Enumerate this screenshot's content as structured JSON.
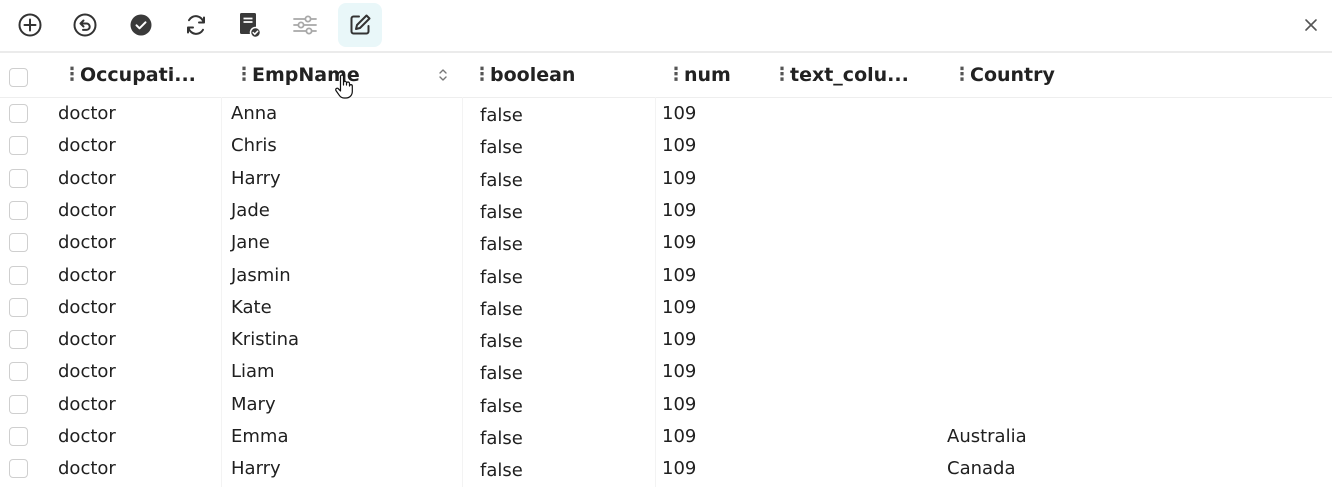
{
  "toolbar": {
    "buttons": [
      {
        "name": "add-row-button",
        "icon": "plus-circle-icon",
        "active": false
      },
      {
        "name": "undo-button",
        "icon": "undo-icon",
        "active": false
      },
      {
        "name": "confirm-button",
        "icon": "check-circle-icon",
        "active": false
      },
      {
        "name": "refresh-button",
        "icon": "refresh-icon",
        "active": false
      },
      {
        "name": "save-changes-button",
        "icon": "document-check-icon",
        "active": false
      },
      {
        "name": "filter-settings-button",
        "icon": "sliders-icon",
        "active": false
      },
      {
        "name": "edit-button",
        "icon": "edit-icon",
        "active": true
      }
    ],
    "close_icon": "close-icon"
  },
  "grid": {
    "columns": [
      {
        "key": "occupation",
        "label": "Occupati..."
      },
      {
        "key": "empname",
        "label": "EmpName"
      },
      {
        "key": "boolean",
        "label": "boolean"
      },
      {
        "key": "num",
        "label": "num"
      },
      {
        "key": "text_column",
        "label": "text_colu..."
      },
      {
        "key": "country",
        "label": "Country"
      }
    ],
    "rows": [
      {
        "occupation": "doctor",
        "empname": "Anna",
        "boolean": "false",
        "num": "109",
        "text_column": "",
        "country": ""
      },
      {
        "occupation": "doctor",
        "empname": "Chris",
        "boolean": "false",
        "num": "109",
        "text_column": "",
        "country": ""
      },
      {
        "occupation": "doctor",
        "empname": "Harry",
        "boolean": "false",
        "num": "109",
        "text_column": "",
        "country": ""
      },
      {
        "occupation": "doctor",
        "empname": "Jade",
        "boolean": "false",
        "num": "109",
        "text_column": "",
        "country": ""
      },
      {
        "occupation": "doctor",
        "empname": "Jane",
        "boolean": "false",
        "num": "109",
        "text_column": "",
        "country": ""
      },
      {
        "occupation": "doctor",
        "empname": "Jasmin",
        "boolean": "false",
        "num": "109",
        "text_column": "",
        "country": ""
      },
      {
        "occupation": "doctor",
        "empname": "Kate",
        "boolean": "false",
        "num": "109",
        "text_column": "",
        "country": ""
      },
      {
        "occupation": "doctor",
        "empname": "Kristina",
        "boolean": "false",
        "num": "109",
        "text_column": "",
        "country": ""
      },
      {
        "occupation": "doctor",
        "empname": "Liam",
        "boolean": "false",
        "num": "109",
        "text_column": "",
        "country": ""
      },
      {
        "occupation": "doctor",
        "empname": "Mary",
        "boolean": "false",
        "num": "109",
        "text_column": "",
        "country": ""
      },
      {
        "occupation": "doctor",
        "empname": "Emma",
        "boolean": "false",
        "num": "109",
        "text_column": "",
        "country": "Australia"
      },
      {
        "occupation": "doctor",
        "empname": "Harry",
        "boolean": "false",
        "num": "109",
        "text_column": "",
        "country": "Canada"
      }
    ]
  },
  "colors": {
    "icon": "#333333",
    "icon_muted": "#9a9a9a",
    "accent_bg": "#e9f7f9",
    "border": "#cfcfcf"
  }
}
